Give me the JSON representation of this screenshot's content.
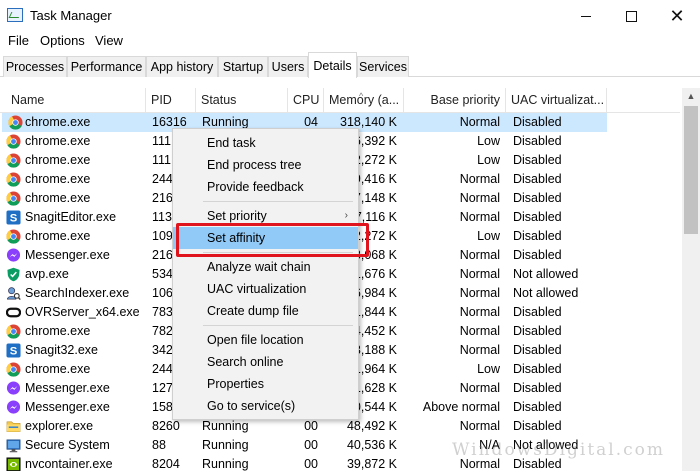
{
  "window": {
    "title": "Task Manager"
  },
  "menu": [
    "File",
    "Options",
    "View"
  ],
  "tabs": [
    "Processes",
    "Performance",
    "App history",
    "Startup",
    "Users",
    "Details",
    "Services"
  ],
  "active_tab": "Details",
  "columns": [
    "Name",
    "PID",
    "Status",
    "CPU",
    "Memory (a...",
    "Base priority",
    "UAC virtualizat..."
  ],
  "rows": [
    {
      "name": "chrome.exe",
      "pid": "16316",
      "status": "Running",
      "cpu": "04",
      "memory": "318,140 K",
      "priority": "Normal",
      "uac": "Disabled",
      "icon": "chrome-icon"
    },
    {
      "name": "chrome.exe",
      "pid": "111",
      "status": "",
      "cpu": "",
      "memory": "6,392 K",
      "priority": "Low",
      "uac": "Disabled",
      "icon": "chrome-icon"
    },
    {
      "name": "chrome.exe",
      "pid": "111",
      "status": "",
      "cpu": "",
      "memory": "2,272 K",
      "priority": "Low",
      "uac": "Disabled",
      "icon": "chrome-icon"
    },
    {
      "name": "chrome.exe",
      "pid": "244",
      "status": "",
      "cpu": "",
      "memory": "9,416 K",
      "priority": "Normal",
      "uac": "Disabled",
      "icon": "chrome-icon"
    },
    {
      "name": "chrome.exe",
      "pid": "216",
      "status": "",
      "cpu": "",
      "memory": "7,148 K",
      "priority": "Normal",
      "uac": "Disabled",
      "icon": "chrome-icon"
    },
    {
      "name": "SnagitEditor.exe",
      "pid": "113",
      "status": "",
      "cpu": "",
      "memory": "7,116 K",
      "priority": "Normal",
      "uac": "Disabled",
      "icon": "snagit-icon"
    },
    {
      "name": "chrome.exe",
      "pid": "109",
      "status": "",
      "cpu": "",
      "memory": "2,272 K",
      "priority": "Low",
      "uac": "Disabled",
      "icon": "chrome-icon"
    },
    {
      "name": "Messenger.exe",
      "pid": "216",
      "status": "",
      "cpu": "",
      "memory": "3,068 K",
      "priority": "Normal",
      "uac": "Disabled",
      "icon": "messenger-icon"
    },
    {
      "name": "avp.exe",
      "pid": "534",
      "status": "",
      "cpu": "",
      "memory": "1,676 K",
      "priority": "Normal",
      "uac": "Not allowed",
      "icon": "shield-icon"
    },
    {
      "name": "SearchIndexer.exe",
      "pid": "106",
      "status": "",
      "cpu": "",
      "memory": "6,984 K",
      "priority": "Normal",
      "uac": "Not allowed",
      "icon": "search-indexer-icon"
    },
    {
      "name": "OVRServer_x64.exe",
      "pid": "783",
      "status": "",
      "cpu": "",
      "memory": "1,844 K",
      "priority": "Normal",
      "uac": "Disabled",
      "icon": "oculus-icon"
    },
    {
      "name": "chrome.exe",
      "pid": "782",
      "status": "",
      "cpu": "",
      "memory": "4,452 K",
      "priority": "Normal",
      "uac": "Disabled",
      "icon": "chrome-icon"
    },
    {
      "name": "Snagit32.exe",
      "pid": "342",
      "status": "",
      "cpu": "",
      "memory": "3,188 K",
      "priority": "Normal",
      "uac": "Disabled",
      "icon": "snagit-icon"
    },
    {
      "name": "chrome.exe",
      "pid": "244",
      "status": "",
      "cpu": "",
      "memory": "1,964 K",
      "priority": "Low",
      "uac": "Disabled",
      "icon": "chrome-icon"
    },
    {
      "name": "Messenger.exe",
      "pid": "127",
      "status": "",
      "cpu": "",
      "memory": "1,628 K",
      "priority": "Normal",
      "uac": "Disabled",
      "icon": "messenger-icon"
    },
    {
      "name": "Messenger.exe",
      "pid": "158",
      "status": "",
      "cpu": "",
      "memory": "0,544 K",
      "priority": "Above normal",
      "uac": "Disabled",
      "icon": "messenger-icon"
    },
    {
      "name": "explorer.exe",
      "pid": "8260",
      "status": "Running",
      "cpu": "00",
      "memory": "48,492 K",
      "priority": "Normal",
      "uac": "Disabled",
      "icon": "folder-icon"
    },
    {
      "name": "Secure System",
      "pid": "88",
      "status": "Running",
      "cpu": "00",
      "memory": "40,536 K",
      "priority": "N/A",
      "uac": "Not allowed",
      "icon": "system-icon"
    },
    {
      "name": "nvcontainer.exe",
      "pid": "8204",
      "status": "Running",
      "cpu": "00",
      "memory": "39,872 K",
      "priority": "Normal",
      "uac": "Disabled",
      "icon": "nvidia-icon"
    }
  ],
  "context_menu": {
    "items": [
      {
        "label": "End task"
      },
      {
        "label": "End process tree"
      },
      {
        "label": "Provide feedback"
      },
      {
        "label": "Set priority",
        "submenu_arrow": "›"
      },
      {
        "label": "Set affinity",
        "highlighted": true
      },
      {
        "label": "Analyze wait chain"
      },
      {
        "label": "UAC virtualization"
      },
      {
        "label": "Create dump file"
      },
      {
        "label": "Open file location"
      },
      {
        "label": "Search online"
      },
      {
        "label": "Properties"
      },
      {
        "label": "Go to service(s)"
      }
    ]
  },
  "watermark": "WindowsDigital.com",
  "colors": {
    "selection": "#cce8ff",
    "menu_highlight": "#91c9f7",
    "annotation_red": "#e0141c",
    "menu_bg": "#f2f2f2"
  }
}
